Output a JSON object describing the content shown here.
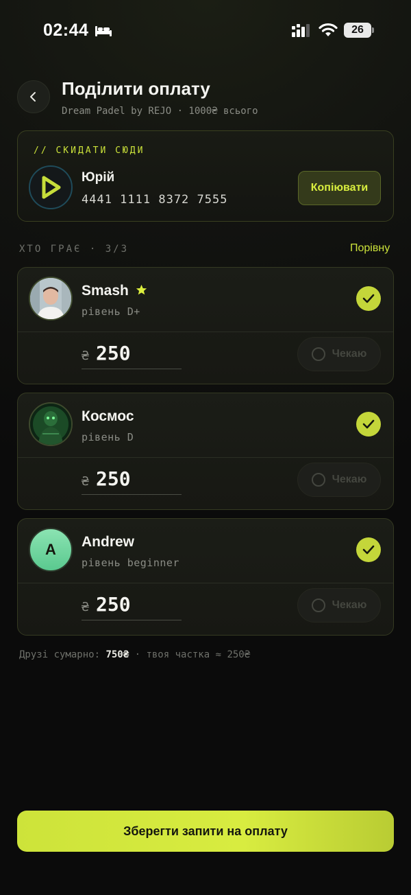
{
  "status_bar": {
    "time": "02:44",
    "battery": "26"
  },
  "header": {
    "title": "Поділити оплату",
    "subtitle": "Dream Padel by REJO · 1000₴ всього"
  },
  "recipient": {
    "label": "// СКИДАТИ СЮДИ",
    "name": "Юрій",
    "card_number": "4441 1111 8372 7555",
    "copy_label": "Копіювати"
  },
  "players_section": {
    "label": "ХТО ГРАЄ · 3/3",
    "split_label": "Порівну"
  },
  "players": [
    {
      "name": "Smash",
      "level": "рівень D+",
      "currency": "₴",
      "amount": "250",
      "status": "Чекаю"
    },
    {
      "name": "Космос",
      "level": "рівень D",
      "currency": "₴",
      "amount": "250",
      "status": "Чекаю"
    },
    {
      "name": "Andrew",
      "level": "рівень beginner",
      "initial": "A",
      "currency": "₴",
      "amount": "250",
      "status": "Чекаю"
    }
  ],
  "summary": {
    "prefix": "Друзі сумарно: ",
    "total": "750₴",
    "suffix": " · твоя частка ≈ 250₴"
  },
  "save_button": "Зберегти запити на оплату",
  "colors": {
    "accent": "#cbe23a",
    "background": "#0b0b0b",
    "card_border": "#353a22"
  }
}
